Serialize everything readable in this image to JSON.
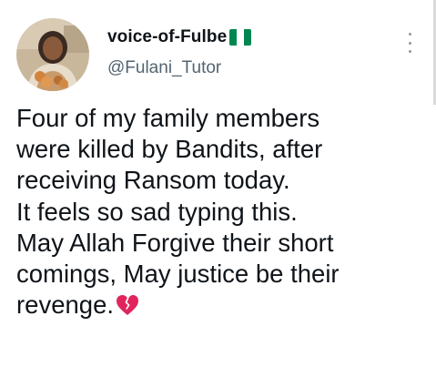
{
  "user": {
    "display_name": "voice-of-Fulbe",
    "handle": "@Fulani_Tutor",
    "flag_icon": "nigeria-flag-icon",
    "flag_colors": [
      "#008751",
      "#ffffff",
      "#008751"
    ]
  },
  "tweet": {
    "lines": [
      "Four of my family members",
      "were killed by Bandits, after",
      "receiving Ransom today.",
      "It feels so sad typing this.",
      "May Allah Forgive their short",
      "comings, May justice be their",
      "revenge."
    ],
    "trailing_emoji": "broken-heart-icon"
  },
  "menu": {
    "icon": "more-options-icon"
  },
  "colors": {
    "text": "#0f1419",
    "secondary": "#536471",
    "emoji_red": "#e0245e"
  }
}
